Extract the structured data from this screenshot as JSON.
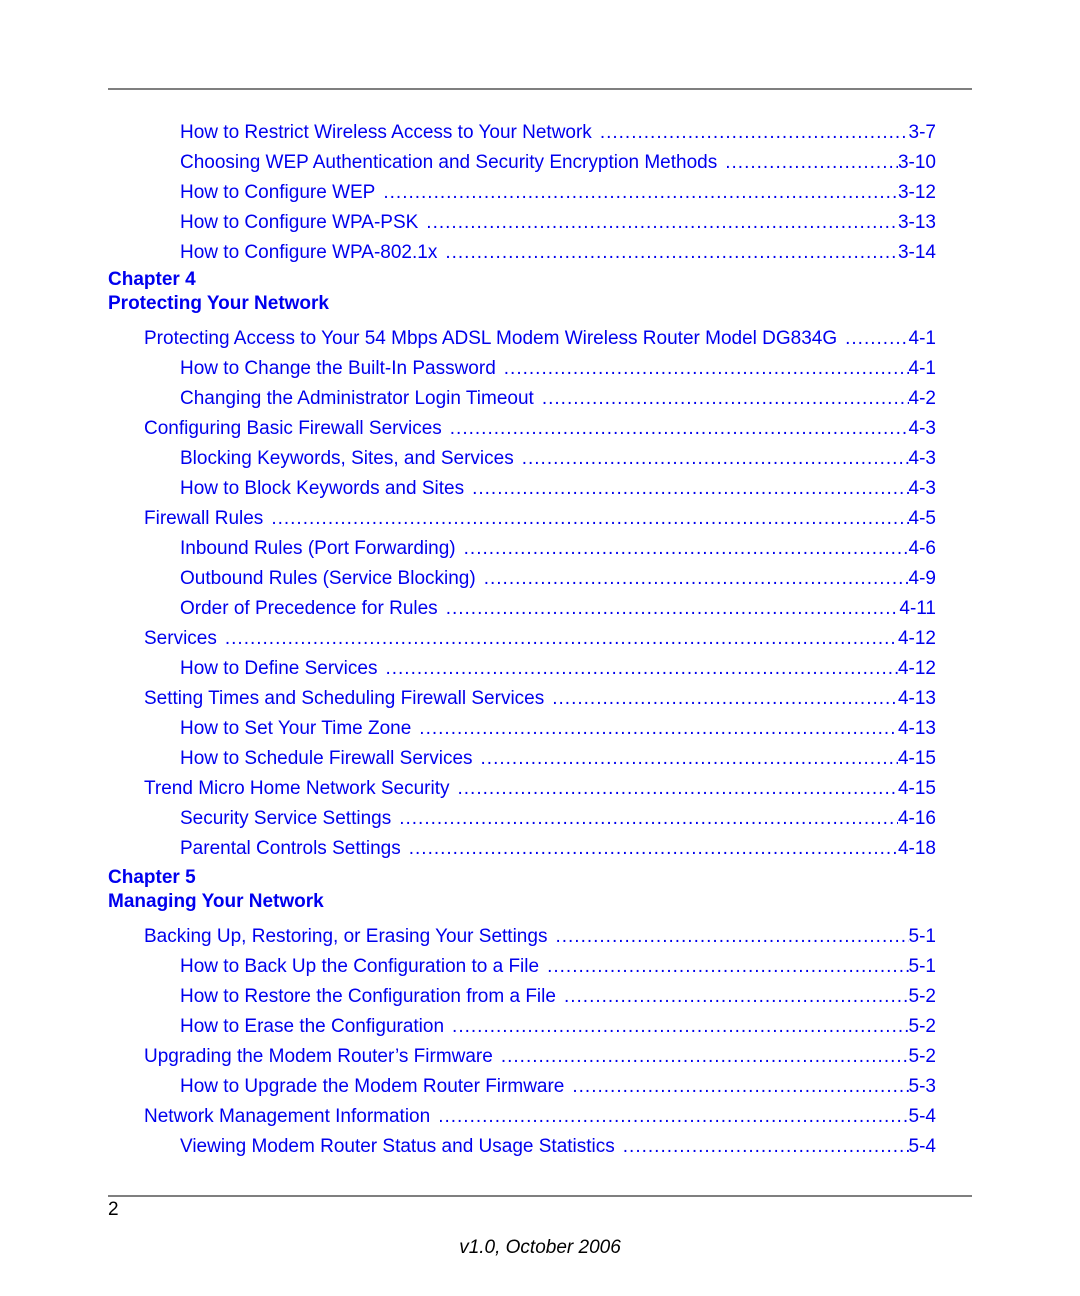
{
  "colors": {
    "link": "#0000ee",
    "rule": "#7f7f7f",
    "text": "#000000"
  },
  "toc_top": [
    {
      "level": 2,
      "title": "How to Restrict Wireless Access to Your Network",
      "page": "3-7"
    },
    {
      "level": 2,
      "title": "Choosing WEP Authentication and Security Encryption Methods",
      "page": "3-10"
    },
    {
      "level": 2,
      "title": "How to Configure WEP",
      "page": "3-12"
    },
    {
      "level": 2,
      "title": "How to Configure WPA-PSK",
      "page": "3-13"
    },
    {
      "level": 2,
      "title": "How to Configure WPA-802.1x",
      "page": "3-14"
    }
  ],
  "chapter4": {
    "number": "Chapter 4",
    "title": "Protecting Your Network",
    "entries": [
      {
        "level": 1,
        "title": "Protecting Access to Your 54 Mbps ADSL Modem Wireless Router Model DG834G",
        "page": "4-1"
      },
      {
        "level": 2,
        "title": "How to Change the Built-In Password",
        "page": "4-1"
      },
      {
        "level": 2,
        "title": "Changing the Administrator Login Timeout",
        "page": "4-2"
      },
      {
        "level": 1,
        "title": "Configuring Basic Firewall Services",
        "page": "4-3"
      },
      {
        "level": 2,
        "title": "Blocking Keywords, Sites, and Services",
        "page": "4-3"
      },
      {
        "level": 2,
        "title": "How to Block Keywords and Sites",
        "page": "4-3"
      },
      {
        "level": 1,
        "title": "Firewall Rules",
        "page": "4-5"
      },
      {
        "level": 2,
        "title": "Inbound Rules (Port Forwarding)",
        "page": "4-6"
      },
      {
        "level": 2,
        "title": "Outbound Rules (Service Blocking)",
        "page": "4-9"
      },
      {
        "level": 2,
        "title": "Order of Precedence for Rules",
        "page": "4-11"
      },
      {
        "level": 1,
        "title": "Services",
        "page": "4-12"
      },
      {
        "level": 2,
        "title": "How to Define Services",
        "page": "4-12"
      },
      {
        "level": 1,
        "title": "Setting Times and Scheduling Firewall Services",
        "page": "4-13"
      },
      {
        "level": 2,
        "title": "How to Set Your Time Zone",
        "page": "4-13"
      },
      {
        "level": 2,
        "title": "How to Schedule Firewall Services",
        "page": "4-15"
      },
      {
        "level": 1,
        "title": "Trend Micro Home Network Security",
        "page": "4-15"
      },
      {
        "level": 2,
        "title": "Security Service Settings",
        "page": "4-16"
      },
      {
        "level": 2,
        "title": "Parental Controls Settings",
        "page": "4-18"
      }
    ]
  },
  "chapter5": {
    "number": "Chapter 5",
    "title": "Managing Your Network",
    "entries": [
      {
        "level": 1,
        "title": "Backing Up, Restoring, or Erasing Your Settings",
        "page": "5-1"
      },
      {
        "level": 2,
        "title": "How to Back Up the Configuration to a File",
        "page": "5-1"
      },
      {
        "level": 2,
        "title": "How to Restore the Configuration from a File",
        "page": "5-2"
      },
      {
        "level": 2,
        "title": "How to Erase the Configuration",
        "page": "5-2"
      },
      {
        "level": 1,
        "title": "Upgrading the Modem Router’s Firmware",
        "page": "5-2"
      },
      {
        "level": 2,
        "title": "How to Upgrade the Modem Router Firmware",
        "page": "5-3"
      },
      {
        "level": 1,
        "title": "Network Management Information",
        "page": "5-4"
      },
      {
        "level": 2,
        "title": "Viewing Modem Router Status and Usage Statistics",
        "page": "5-4"
      }
    ]
  },
  "footer": {
    "page_number": "2",
    "version": "v1.0, October 2006"
  }
}
